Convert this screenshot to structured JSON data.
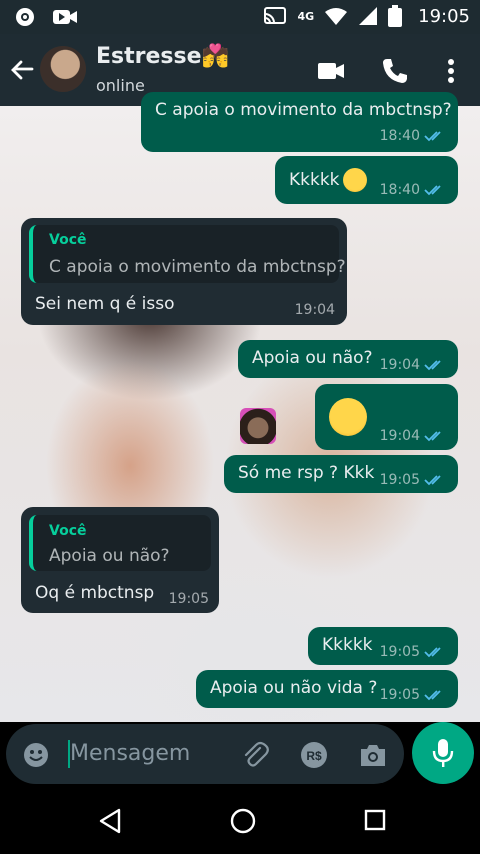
{
  "status_bar": {
    "time": "19:05",
    "network": "4G"
  },
  "header": {
    "contact_name": "Estresse💏",
    "presence": "online"
  },
  "messages": [
    {
      "text": "C apoia o movimento da mbctnsp?",
      "time": "18:40"
    },
    {
      "text": "Kkkkk",
      "time": "18:40"
    },
    {
      "quote_author": "Você",
      "quote_text": "C apoia o movimento da mbctnsp?",
      "text": "Sei nem q é isso",
      "time": "19:04"
    },
    {
      "text": "Apoia ou não?",
      "time": "19:04"
    },
    {
      "text": "",
      "time": "19:04"
    },
    {
      "text": "Só me rsp ? Kkk",
      "time": "19:05"
    },
    {
      "quote_author": "Você",
      "quote_text": "Apoia ou não?",
      "text": "Oq é mbctnsp",
      "time": "19:05"
    },
    {
      "text": "Kkkkk",
      "time": "19:05"
    },
    {
      "text": "Apoia ou não vida ?",
      "time": "19:05"
    }
  ],
  "composer": {
    "placeholder": "Mensagem"
  },
  "colors": {
    "outgoing_bubble": "#005c4b",
    "incoming_bubble": "#202c33",
    "accent": "#00a884",
    "read_ticks": "#53bdeb"
  },
  "icons": [
    "camera-icon",
    "video-icon",
    "cast-icon",
    "wifi-icon",
    "signal-icon",
    "battery-icon",
    "back-arrow-icon",
    "video-call-icon",
    "phone-icon",
    "more-icon",
    "emoji-icon",
    "attach-icon",
    "payment-icon",
    "camera-icon",
    "mic-icon",
    "nav-back-icon",
    "nav-home-icon",
    "nav-recents-icon"
  ]
}
